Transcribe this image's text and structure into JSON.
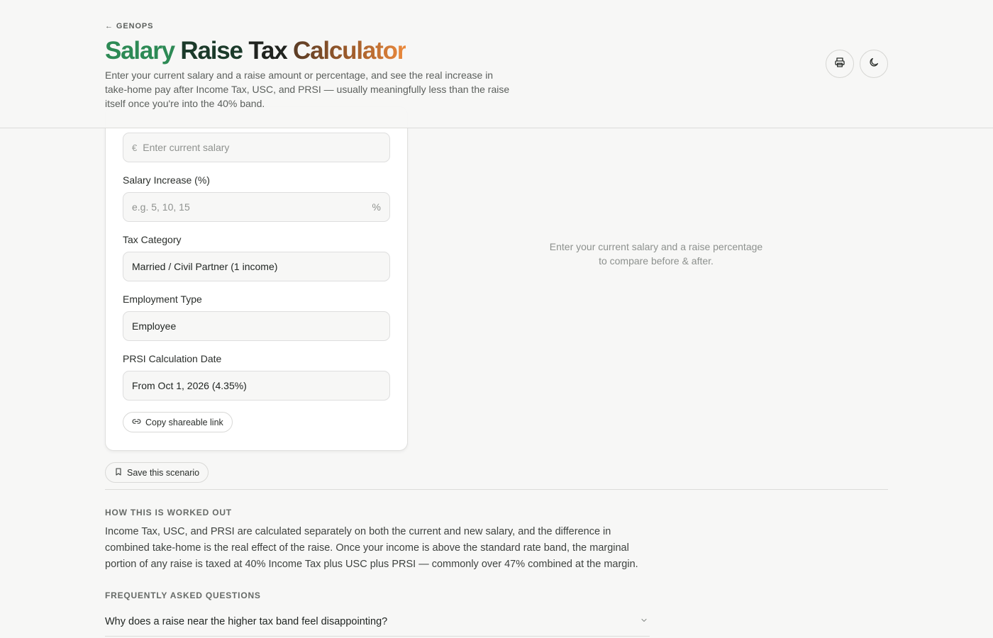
{
  "header": {
    "back_label": "GENOPS",
    "title_words": [
      "Salary",
      "Raise",
      "Tax",
      "Calculator"
    ],
    "subtitle": "Enter your current salary and a raise amount or percentage, and see the real increase in take-home pay after Income Tax, USC, and PRSI — usually meaningfully less than the raise itself once you're into the 40% band.",
    "buttons": [
      {
        "icon": "printer-icon"
      },
      {
        "icon": "moon-icon"
      }
    ]
  },
  "form": {
    "current_salary": {
      "prefix": "€",
      "placeholder": "Enter current salary",
      "value": ""
    },
    "increase": {
      "label": "Salary Increase (%)",
      "placeholder": "e.g. 5, 10, 15",
      "suffix": "%",
      "value": ""
    },
    "tax_category": {
      "label": "Tax Category",
      "selected": "Married / Civil Partner (1 income)"
    },
    "employment_type": {
      "label": "Employment Type",
      "selected": "Employee"
    },
    "prsi_date": {
      "label": "PRSI Calculation Date",
      "selected": "From Oct 1, 2026 (4.35%)"
    },
    "copy_link_label": "Copy shareable link"
  },
  "save_label": "Save this scenario",
  "results": {
    "empty_line1": "Enter your current salary and a raise percentage",
    "empty_line2": "to compare before & after."
  },
  "method": {
    "heading": "HOW THIS IS WORKED OUT",
    "text": "Income Tax, USC, and PRSI are calculated separately on both the current and new salary, and the difference in combined take-home is the real effect of the raise. Once your income is above the standard rate band, the marginal portion of any raise is taxed at 40% Income Tax plus USC plus PRSI — commonly over 47% combined at the margin."
  },
  "faq": {
    "heading": "FREQUENTLY ASKED QUESTIONS",
    "items": [
      {
        "question": "Why does a raise near the higher tax band feel disappointing?"
      }
    ]
  }
}
